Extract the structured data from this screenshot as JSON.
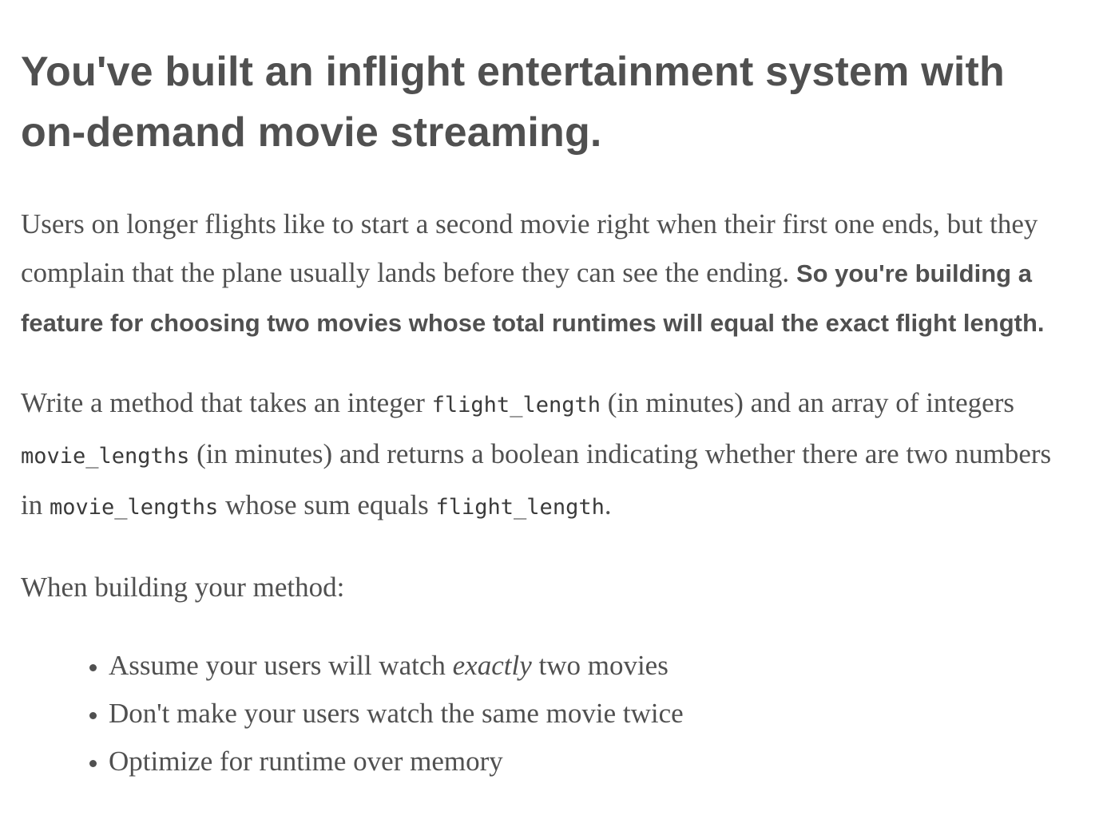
{
  "heading": "You've built an inflight entertainment system with on-demand movie streaming.",
  "paragraph1": {
    "text": "Users on longer flights like to start a second movie right when their first one ends, but they complain that the plane usually lands before they can see the ending.",
    "bold": "So you're building a feature for choosing two movies whose total runtimes will equal the exact flight length."
  },
  "paragraph2": {
    "t1": "Write a method that takes an integer ",
    "c1": "flight_length",
    "t2": " (in minutes) and an array of integers ",
    "c2": "movie_lengths",
    "t3": " (in minutes) and returns a boolean indicating whether there are two numbers in ",
    "c3": "movie_lengths",
    "t4": " whose sum equals ",
    "c4": "flight_length",
    "t5": "."
  },
  "paragraph3": "When building your method:",
  "list": {
    "item1": {
      "before": "Assume your users will watch ",
      "emphasis": "exactly",
      "after": " two movies"
    },
    "item2": "Don't make your users watch the same movie twice",
    "item3": "Optimize for runtime over memory"
  }
}
